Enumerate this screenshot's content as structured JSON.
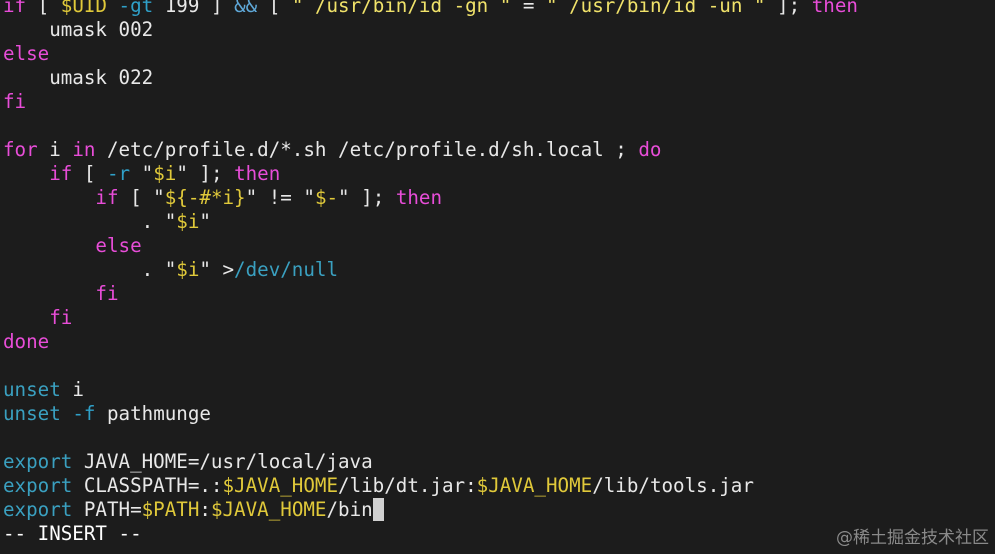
{
  "colors": {
    "background": "#1c1c1c",
    "text": "#e8e8e8",
    "keyword": "#e84dd8",
    "string": "#f0e26a",
    "variable": "#e0c93a",
    "option": "#2fa0c8",
    "path": "#3aa0c0",
    "punct": "#5fa8d8"
  },
  "editor": {
    "lines": [
      [
        [
          "if",
          "keyword"
        ],
        [
          " [ ",
          "text"
        ],
        [
          "$UID",
          "variable"
        ],
        [
          " ",
          "text"
        ],
        [
          "-gt",
          "option"
        ],
        [
          " 199 ] ",
          "text"
        ],
        [
          "&&",
          "punct"
        ],
        [
          " [ ",
          "text"
        ],
        [
          "\"`/usr/bin/id -gn`\"",
          "string"
        ],
        [
          " = ",
          "text"
        ],
        [
          "\"`/usr/bin/id -un`\"",
          "string"
        ],
        [
          " ]; ",
          "text"
        ],
        [
          "then",
          "keyword"
        ]
      ],
      [
        [
          "    umask 002",
          "text"
        ]
      ],
      [
        [
          "else",
          "keyword"
        ]
      ],
      [
        [
          "    umask 022",
          "text"
        ]
      ],
      [
        [
          "fi",
          "keyword"
        ]
      ],
      [],
      [
        [
          "for",
          "keyword"
        ],
        [
          " i ",
          "text"
        ],
        [
          "in",
          "keyword"
        ],
        [
          " /etc/profile.d/*.sh /etc/profile.d/sh.local ; ",
          "text"
        ],
        [
          "do",
          "keyword"
        ]
      ],
      [
        [
          "    ",
          "text"
        ],
        [
          "if",
          "keyword"
        ],
        [
          " [ ",
          "text"
        ],
        [
          "-r",
          "option"
        ],
        [
          " \"",
          "text"
        ],
        [
          "$i",
          "variable"
        ],
        [
          "\" ]; ",
          "text"
        ],
        [
          "then",
          "keyword"
        ]
      ],
      [
        [
          "        ",
          "text"
        ],
        [
          "if",
          "keyword"
        ],
        [
          " [ \"",
          "text"
        ],
        [
          "${-#*i}",
          "variable"
        ],
        [
          "\" != \"",
          "text"
        ],
        [
          "$-",
          "variable"
        ],
        [
          "\" ]; ",
          "text"
        ],
        [
          "then",
          "keyword"
        ]
      ],
      [
        [
          "            . \"",
          "text"
        ],
        [
          "$i",
          "variable"
        ],
        [
          "\"",
          "text"
        ]
      ],
      [
        [
          "        ",
          "text"
        ],
        [
          "else",
          "keyword"
        ]
      ],
      [
        [
          "            . \"",
          "text"
        ],
        [
          "$i",
          "variable"
        ],
        [
          "\" >",
          "text"
        ],
        [
          "/dev/null",
          "path"
        ]
      ],
      [
        [
          "        ",
          "text"
        ],
        [
          "fi",
          "keyword"
        ]
      ],
      [
        [
          "    ",
          "text"
        ],
        [
          "fi",
          "keyword"
        ]
      ],
      [
        [
          "done",
          "keyword"
        ]
      ],
      [],
      [
        [
          "unset",
          "path"
        ],
        [
          " i",
          "text"
        ]
      ],
      [
        [
          "unset",
          "path"
        ],
        [
          " ",
          "text"
        ],
        [
          "-f",
          "option"
        ],
        [
          " pathmunge",
          "text"
        ]
      ],
      [],
      [
        [
          "export",
          "path"
        ],
        [
          " JAVA_HOME=/usr/local/java",
          "text"
        ]
      ],
      [
        [
          "export",
          "path"
        ],
        [
          " CLASSPATH=.:",
          "text"
        ],
        [
          "$JAVA_HOME",
          "variable"
        ],
        [
          "/lib/dt.jar:",
          "text"
        ],
        [
          "$JAVA_HOME",
          "variable"
        ],
        [
          "/lib/tools.jar",
          "text"
        ]
      ],
      [
        [
          "export",
          "path"
        ],
        [
          " PATH=",
          "text"
        ],
        [
          "$PATH",
          "variable"
        ],
        [
          ":",
          "text"
        ],
        [
          "$JAVA_HOME",
          "variable"
        ],
        [
          "/bin",
          "text"
        ],
        [
          " ",
          "cursor"
        ]
      ],
      [
        [
          "-- INSERT --",
          "status"
        ]
      ]
    ]
  },
  "watermark": "@稀土掘金技术社区"
}
